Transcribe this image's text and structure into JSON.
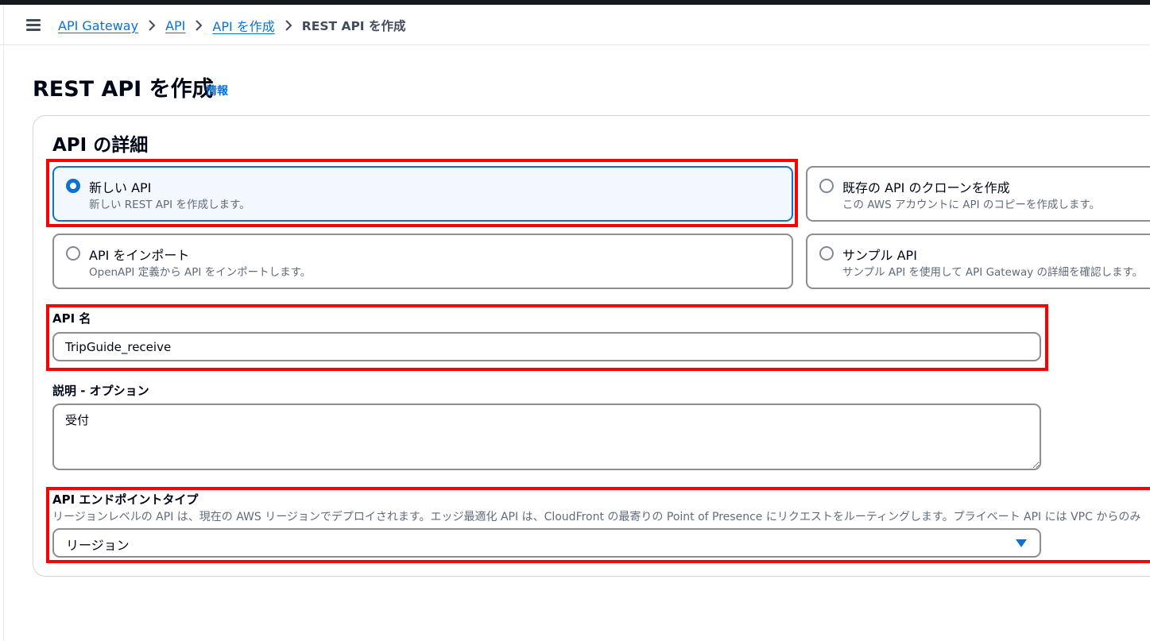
{
  "breadcrumb": {
    "items": [
      "API Gateway",
      "API",
      "API を作成"
    ],
    "current": "REST API を作成"
  },
  "page": {
    "title": "REST API を作成",
    "info_link": "情報"
  },
  "api_details": {
    "heading": "API の詳細",
    "options": {
      "new": {
        "label": "新しい API",
        "description": "新しい REST API を作成します。",
        "selected": true
      },
      "clone": {
        "label": "既存の API のクローンを作成",
        "description": "この AWS アカウントに API のコピーを作成します。",
        "selected": false
      },
      "import": {
        "label": "API をインポート",
        "description": "OpenAPI 定義から API をインポートします。",
        "selected": false
      },
      "sample": {
        "label": "サンプル API",
        "description": "サンプル API を使用して API Gateway の詳細を確認します。",
        "selected": false
      }
    }
  },
  "form": {
    "api_name": {
      "label": "API 名",
      "value": "TripGuide_receive"
    },
    "description": {
      "label": "説明 - オプション",
      "value": "受付"
    },
    "endpoint_type": {
      "label": "API エンドポイントタイプ",
      "description": "リージョンレベルの API は、現在の AWS リージョンでデプロイされます。エッジ最適化 API は、CloudFront の最寄りの Point of Presence にリクエストをルーティングします。プライベート API には VPC からのみ",
      "selected": "リージョン"
    }
  },
  "colors": {
    "accent": "#0972d3",
    "highlight_box": "#ff0000",
    "selected_tile_bg": "#f2f8fd"
  },
  "icons": [
    "menu-icon",
    "chevron-right-icon",
    "caret-down-icon"
  ]
}
